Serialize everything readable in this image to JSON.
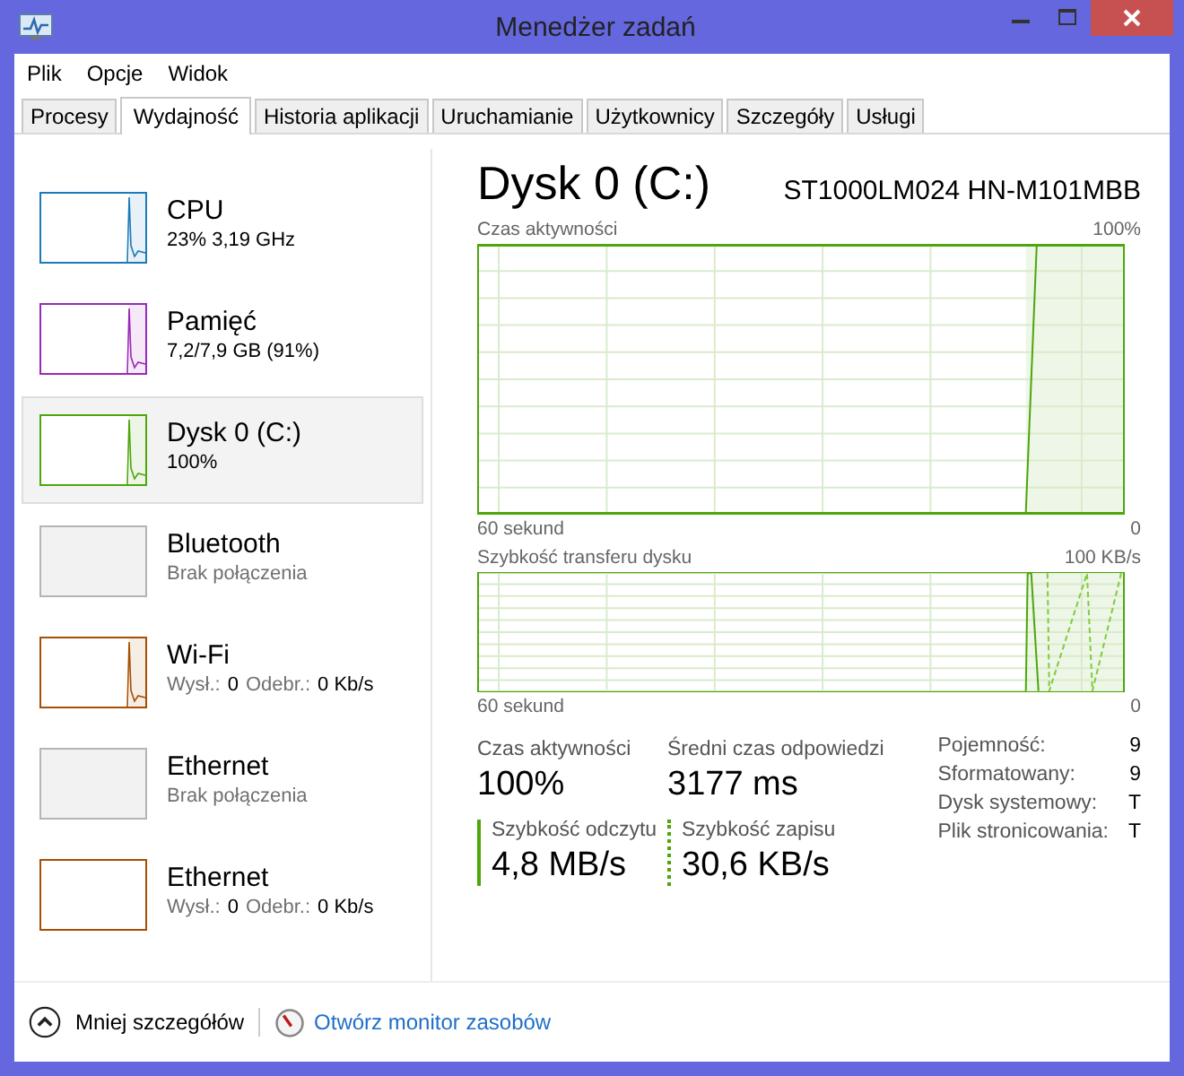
{
  "window": {
    "title": "Menedżer zadań"
  },
  "menu": [
    "Plik",
    "Opcje",
    "Widok"
  ],
  "tabs": [
    {
      "label": "Procesy",
      "selected": false
    },
    {
      "label": "Wydajność",
      "selected": true
    },
    {
      "label": "Historia aplikacji",
      "selected": false
    },
    {
      "label": "Uruchamianie",
      "selected": false
    },
    {
      "label": "Użytkownicy",
      "selected": false
    },
    {
      "label": "Szczegóły",
      "selected": false
    },
    {
      "label": "Usługi",
      "selected": false
    }
  ],
  "sidebar": {
    "items": [
      {
        "name": "CPU",
        "kind": "graph",
        "color": "#1c7ab8",
        "selected": false,
        "detail": [
          {
            "text": "23% 3,19 GHz",
            "dim": false
          }
        ]
      },
      {
        "name": "Pamięć",
        "kind": "graph",
        "color": "#9b28b6",
        "selected": false,
        "detail": [
          {
            "text": "7,2/7,9 GB (91%)",
            "dim": false
          }
        ]
      },
      {
        "name": "Dysk 0 (C:)",
        "kind": "graph",
        "color": "#4da60c",
        "selected": true,
        "detail": [
          {
            "text": "100%",
            "dim": false
          }
        ]
      },
      {
        "name": "Bluetooth",
        "kind": "disconnected",
        "color": "#b5b5b5",
        "selected": false,
        "detail": [
          {
            "text": "Brak połączenia",
            "dim": true
          }
        ]
      },
      {
        "name": "Wi-Fi",
        "kind": "graph",
        "color": "#a74f01",
        "selected": false,
        "detail": [
          {
            "text": "Wysł.:",
            "dim": true
          },
          {
            "text": "0",
            "dim": false
          },
          {
            "text": "Odebr.:",
            "dim": true
          },
          {
            "text": "0 Kb/s",
            "dim": false
          }
        ]
      },
      {
        "name": "Ethernet",
        "kind": "disconnected",
        "color": "#b5b5b5",
        "selected": false,
        "detail": [
          {
            "text": "Brak połączenia",
            "dim": true
          }
        ]
      },
      {
        "name": "Ethernet",
        "kind": "empty",
        "color": "#a74f01",
        "selected": false,
        "detail": [
          {
            "text": "Wysł.:",
            "dim": true
          },
          {
            "text": "0",
            "dim": false
          },
          {
            "text": "Odebr.:",
            "dim": true
          },
          {
            "text": "0 Kb/s",
            "dim": false
          }
        ]
      }
    ]
  },
  "panel": {
    "title": "Dysk 0 (C:)",
    "model": "ST1000LM024 HN-M101MBB",
    "graphs": [
      {
        "kind": "activity",
        "label": "Czas aktywności",
        "max": "100%",
        "time": "60 sekund",
        "min": "0"
      },
      {
        "kind": "transfer",
        "label": "Szybkość transferu dysku",
        "max": "100 KB/s",
        "time": "60 sekund",
        "min": "0"
      }
    ],
    "stats": [
      {
        "kind": "plain",
        "label": "Czas aktywności",
        "value": "100%"
      },
      {
        "kind": "plain",
        "label": "Średni czas odpowiedzi",
        "value": "3177 ms"
      },
      {
        "kind": "read",
        "label": "Szybkość odczytu",
        "value": "4,8 MB/s"
      },
      {
        "kind": "write",
        "label": "Szybkość zapisu",
        "value": "30,6 KB/s"
      }
    ],
    "properties": [
      {
        "label": "Pojemność:",
        "value": "9"
      },
      {
        "label": "Sformatowany:",
        "value": "9"
      },
      {
        "label": "Dysk systemowy:",
        "value": "T"
      },
      {
        "label": "Plik stronicowania:",
        "value": "T"
      }
    ]
  },
  "footer": {
    "less_details": "Mniej szczegółów",
    "monitor_link": "Otwórz monitor zasobów"
  }
}
